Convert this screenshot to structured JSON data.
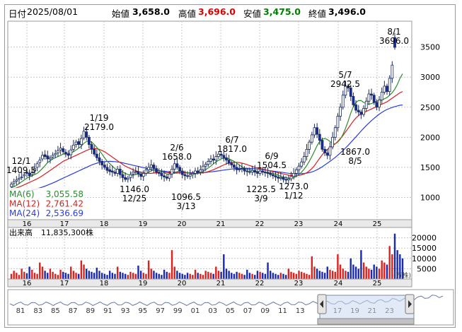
{
  "header": {
    "date_label": "日付",
    "date": "2025/08/01",
    "open_label": "始値",
    "open": "3,658.0",
    "high_label": "高値",
    "high": "3,696.0",
    "low_label": "安値",
    "low": "3,475.0",
    "close_label": "終値",
    "close": "3,496.0"
  },
  "colors": {
    "up": "#ffffff",
    "down": "#1a2a9c",
    "ma6": "#2e8b2e",
    "ma12": "#d82020",
    "ma24": "#2a3be0",
    "vol_up": "#e0201c",
    "vol_down": "#1a2ab0",
    "high_text": "#e00000",
    "low_text": "#008000"
  },
  "ma_legend": [
    {
      "label": "MA(6)",
      "value": "3,055.58",
      "color": "#2e8b2e"
    },
    {
      "label": "MA(12)",
      "value": "2,761.42",
      "color": "#d82020"
    },
    {
      "label": "MA(24)",
      "value": "2,536.69",
      "color": "#2a3be0"
    }
  ],
  "volume": {
    "title": "出来高",
    "value": "11,835,300株",
    "ticks": [
      "20000",
      "15000",
      "10000",
      "5000"
    ],
    "unit": "(万株)"
  },
  "navigator": {
    "labels": [
      "81",
      "83",
      "85",
      "87",
      "89",
      "91",
      "93",
      "95",
      "97",
      "99",
      "01",
      "03",
      "05",
      "07",
      "09",
      "11",
      "13",
      "17",
      "19",
      "21",
      "23"
    ]
  },
  "chart_data": {
    "type": "candlestick",
    "x_axis_labels": [
      "16",
      "17",
      "18",
      "19",
      "20",
      "21",
      "22",
      "23",
      "24",
      "25"
    ],
    "y_ticks": [
      1000,
      1500,
      2000,
      2500,
      3000,
      3500
    ],
    "ylim": [
      630,
      3930
    ],
    "annotations": [
      {
        "date": "12/1",
        "value": "1409.5",
        "kind": "high"
      },
      {
        "date": "1/19",
        "value": "2179.0",
        "kind": "high"
      },
      {
        "date": "12/25",
        "value": "1146.0",
        "kind": "low"
      },
      {
        "date": "2/6",
        "value": "1658.0",
        "kind": "high"
      },
      {
        "date": "3/13",
        "value": "1096.5",
        "kind": "low"
      },
      {
        "date": "6/7",
        "value": "1817.0",
        "kind": "high"
      },
      {
        "date": "6/9",
        "value": "1504.5",
        "kind": "high"
      },
      {
        "date": "3/9",
        "value": "1225.5",
        "kind": "low"
      },
      {
        "date": "1/12",
        "value": "1273.0",
        "kind": "low"
      },
      {
        "date": "5/7",
        "value": "2942.5",
        "kind": "high"
      },
      {
        "date": "8/5",
        "value": "1867.0",
        "kind": "low"
      },
      {
        "date": "8/1",
        "value": "3696.0",
        "kind": "high"
      }
    ],
    "closes": [
      1220,
      1260,
      1290,
      1320,
      1340,
      1380,
      1400,
      1360,
      1420,
      1480,
      1560,
      1620,
      1700,
      1680,
      1640,
      1660,
      1700,
      1730,
      1780,
      1820,
      1760,
      1720,
      1700,
      1790,
      1870,
      1920,
      1880,
      1980,
      2100,
      2000,
      1880,
      1800,
      1720,
      1660,
      1600,
      1540,
      1500,
      1450,
      1430,
      1420,
      1400,
      1470,
      1380,
      1330,
      1300,
      1320,
      1380,
      1420,
      1430,
      1390,
      1350,
      1400,
      1460,
      1500,
      1540,
      1480,
      1420,
      1400,
      1360,
      1340,
      1320,
      1390,
      1470,
      1560,
      1500,
      1440,
      1380,
      1360,
      1350,
      1380,
      1400,
      1440,
      1420,
      1460,
      1520,
      1550,
      1600,
      1640,
      1620,
      1680,
      1720,
      1700,
      1660,
      1620,
      1570,
      1540,
      1500,
      1460,
      1470,
      1480,
      1440,
      1430,
      1420,
      1450,
      1420,
      1400,
      1440,
      1420,
      1410,
      1400,
      1380,
      1360,
      1340,
      1320,
      1330,
      1300,
      1290,
      1310,
      1350,
      1400,
      1460,
      1520,
      1590,
      1680,
      1800,
      1920,
      2040,
      2160,
      2050,
      1950,
      1800,
      1740,
      1700,
      1840,
      2000,
      2160,
      2350,
      2500,
      2700,
      2850,
      2820,
      2680,
      2540,
      2450,
      2420,
      2380,
      2480,
      2600,
      2720,
      2700,
      2580,
      2500,
      2620,
      2750,
      2850,
      2760,
      2980,
      3200,
      3496
    ],
    "opens": [
      1180,
      1230,
      1270,
      1300,
      1330,
      1360,
      1420,
      1400,
      1380,
      1440,
      1500,
      1580,
      1640,
      1710,
      1690,
      1640,
      1670,
      1710,
      1740,
      1790,
      1810,
      1750,
      1720,
      1710,
      1800,
      1880,
      1930,
      1880,
      1990,
      2090,
      2000,
      1880,
      1800,
      1720,
      1660,
      1600,
      1540,
      1500,
      1460,
      1440,
      1420,
      1400,
      1470,
      1380,
      1330,
      1300,
      1330,
      1390,
      1420,
      1430,
      1390,
      1350,
      1400,
      1460,
      1500,
      1540,
      1480,
      1420,
      1400,
      1360,
      1340,
      1320,
      1390,
      1470,
      1560,
      1500,
      1440,
      1380,
      1360,
      1350,
      1380,
      1400,
      1440,
      1420,
      1460,
      1520,
      1550,
      1600,
      1640,
      1620,
      1680,
      1720,
      1700,
      1660,
      1620,
      1570,
      1540,
      1500,
      1460,
      1470,
      1480,
      1440,
      1430,
      1420,
      1450,
      1420,
      1400,
      1440,
      1420,
      1410,
      1400,
      1380,
      1360,
      1340,
      1320,
      1330,
      1300,
      1290,
      1310,
      1350,
      1400,
      1460,
      1520,
      1590,
      1680,
      1800,
      1920,
      2040,
      2160,
      2050,
      1950,
      1800,
      1740,
      1700,
      1840,
      2000,
      2160,
      2350,
      2500,
      2700,
      2850,
      2820,
      2680,
      2540,
      2450,
      2420,
      2380,
      2480,
      2600,
      2720,
      2700,
      2580,
      2500,
      2620,
      2750,
      2850,
      2760,
      2980,
      3658
    ],
    "ma6": [
      1160,
      1180,
      1200,
      1230,
      1260,
      1290,
      1320,
      1340,
      1360,
      1380,
      1400,
      1440,
      1480,
      1530,
      1580,
      1610,
      1640,
      1660,
      1680,
      1700,
      1720,
      1730,
      1730,
      1740,
      1760,
      1790,
      1820,
      1850,
      1900,
      1930,
      1940,
      1920,
      1880,
      1830,
      1780,
      1720,
      1660,
      1600,
      1560,
      1520,
      1480,
      1450,
      1440,
      1420,
      1400,
      1380,
      1370,
      1370,
      1380,
      1390,
      1390,
      1400,
      1410,
      1420,
      1440,
      1460,
      1460,
      1450,
      1430,
      1410,
      1390,
      1380,
      1390,
      1410,
      1430,
      1440,
      1430,
      1420,
      1410,
      1400,
      1390,
      1390,
      1400,
      1410,
      1430,
      1460,
      1490,
      1520,
      1560,
      1590,
      1620,
      1640,
      1650,
      1650,
      1640,
      1620,
      1600,
      1570,
      1540,
      1510,
      1490,
      1470,
      1460,
      1450,
      1440,
      1430,
      1430,
      1430,
      1420,
      1420,
      1410,
      1400,
      1390,
      1370,
      1350,
      1340,
      1330,
      1320,
      1320,
      1330,
      1350,
      1380,
      1420,
      1470,
      1530,
      1600,
      1680,
      1770,
      1860,
      1930,
      1970,
      1980,
      1960,
      1930,
      1900,
      1890,
      1920,
      1970,
      2050,
      2150,
      2270,
      2400,
      2510,
      2580,
      2610,
      2610,
      2580,
      2560,
      2550,
      2560,
      2580,
      2600,
      2610,
      2620,
      2640,
      2660,
      2700,
      2740,
      2800,
      2880,
      2980,
      3056
    ],
    "ma12": [
      1130,
      1145,
      1160,
      1175,
      1190,
      1210,
      1230,
      1250,
      1270,
      1290,
      1310,
      1335,
      1360,
      1390,
      1420,
      1450,
      1480,
      1510,
      1540,
      1570,
      1600,
      1620,
      1640,
      1660,
      1680,
      1700,
      1720,
      1740,
      1760,
      1780,
      1800,
      1810,
      1815,
      1810,
      1800,
      1780,
      1760,
      1730,
      1700,
      1670,
      1640,
      1610,
      1580,
      1550,
      1520,
      1500,
      1480,
      1460,
      1445,
      1430,
      1420,
      1410,
      1405,
      1400,
      1400,
      1405,
      1410,
      1415,
      1420,
      1420,
      1415,
      1410,
      1405,
      1405,
      1405,
      1410,
      1410,
      1410,
      1410,
      1405,
      1400,
      1400,
      1400,
      1405,
      1410,
      1420,
      1430,
      1445,
      1460,
      1480,
      1500,
      1520,
      1540,
      1560,
      1570,
      1580,
      1585,
      1585,
      1580,
      1570,
      1560,
      1545,
      1530,
      1515,
      1500,
      1490,
      1480,
      1470,
      1460,
      1450,
      1440,
      1430,
      1420,
      1410,
      1400,
      1390,
      1380,
      1370,
      1365,
      1360,
      1360,
      1365,
      1375,
      1390,
      1410,
      1440,
      1480,
      1530,
      1590,
      1650,
      1710,
      1760,
      1800,
      1830,
      1860,
      1890,
      1930,
      1980,
      2030,
      2090,
      2150,
      2210,
      2270,
      2320,
      2360,
      2390,
      2410,
      2430,
      2450,
      2470,
      2490,
      2510,
      2530,
      2550,
      2570,
      2590,
      2620,
      2650,
      2680,
      2710,
      2740,
      2761
    ],
    "ma24": [
      1050,
      1058,
      1066,
      1074,
      1082,
      1090,
      1100,
      1110,
      1120,
      1132,
      1144,
      1158,
      1172,
      1188,
      1204,
      1222,
      1240,
      1260,
      1280,
      1300,
      1320,
      1340,
      1360,
      1380,
      1400,
      1420,
      1440,
      1460,
      1480,
      1500,
      1520,
      1540,
      1555,
      1570,
      1580,
      1590,
      1595,
      1598,
      1600,
      1598,
      1595,
      1590,
      1585,
      1575,
      1565,
      1555,
      1545,
      1535,
      1525,
      1515,
      1505,
      1495,
      1485,
      1475,
      1465,
      1458,
      1452,
      1446,
      1440,
      1435,
      1430,
      1425,
      1420,
      1418,
      1416,
      1414,
      1412,
      1410,
      1410,
      1410,
      1410,
      1410,
      1410,
      1412,
      1414,
      1416,
      1420,
      1425,
      1430,
      1436,
      1442,
      1448,
      1454,
      1460,
      1466,
      1472,
      1476,
      1480,
      1482,
      1484,
      1484,
      1484,
      1482,
      1480,
      1476,
      1472,
      1468,
      1462,
      1456,
      1450,
      1444,
      1438,
      1432,
      1426,
      1420,
      1414,
      1408,
      1402,
      1398,
      1394,
      1392,
      1392,
      1394,
      1398,
      1404,
      1412,
      1424,
      1440,
      1460,
      1484,
      1510,
      1540,
      1570,
      1600,
      1632,
      1666,
      1702,
      1740,
      1780,
      1822,
      1866,
      1912,
      1960,
      2008,
      2056,
      2104,
      2150,
      2194,
      2236,
      2276,
      2314,
      2350,
      2384,
      2414,
      2440,
      2462,
      2480,
      2496,
      2510,
      2522,
      2532,
      2537
    ],
    "volumes": [
      2500,
      4000,
      3000,
      2000,
      5000,
      3500,
      2800,
      6000,
      4500,
      3000,
      2500,
      8000,
      6000,
      4000,
      3000,
      5000,
      3500,
      2500,
      2000,
      4500,
      3500,
      3000,
      2500,
      6000,
      4000,
      3000,
      2500,
      9000,
      7000,
      5000,
      4000,
      3500,
      3000,
      5500,
      4000,
      3000,
      2500,
      2000,
      4000,
      3000,
      2500,
      6000,
      3500,
      3000,
      2500,
      2000,
      3500,
      3000,
      2500,
      6500,
      4000,
      3000,
      2500,
      9000,
      5000,
      4000,
      3000,
      2500,
      2000,
      4500,
      3500,
      3000,
      14000,
      6000,
      4000,
      3000,
      2500,
      2000,
      3000,
      2500,
      2000,
      4500,
      3000,
      2500,
      2000,
      4000,
      3500,
      3000,
      2500,
      6000,
      4000,
      3500,
      12000,
      5000,
      4000,
      3000,
      2500,
      3500,
      3000,
      2500,
      2000,
      4500,
      3000,
      2500,
      2000,
      4000,
      3500,
      3000,
      2500,
      8000,
      4000,
      3000,
      2500,
      2000,
      3000,
      2500,
      2000,
      5000,
      3500,
      3000,
      2500,
      4000,
      3500,
      3000,
      2500,
      2000,
      11000,
      6000,
      5000,
      4000,
      3500,
      3000,
      6000,
      4500,
      4000,
      3500,
      12000,
      7000,
      5000,
      4000,
      3500,
      10000,
      7000,
      6000,
      5000,
      14000,
      8000,
      6000,
      5000,
      4500,
      7000,
      6000,
      5000,
      9000,
      8000,
      7000,
      16000,
      12000,
      22000,
      14000,
      12000,
      10000
    ]
  }
}
